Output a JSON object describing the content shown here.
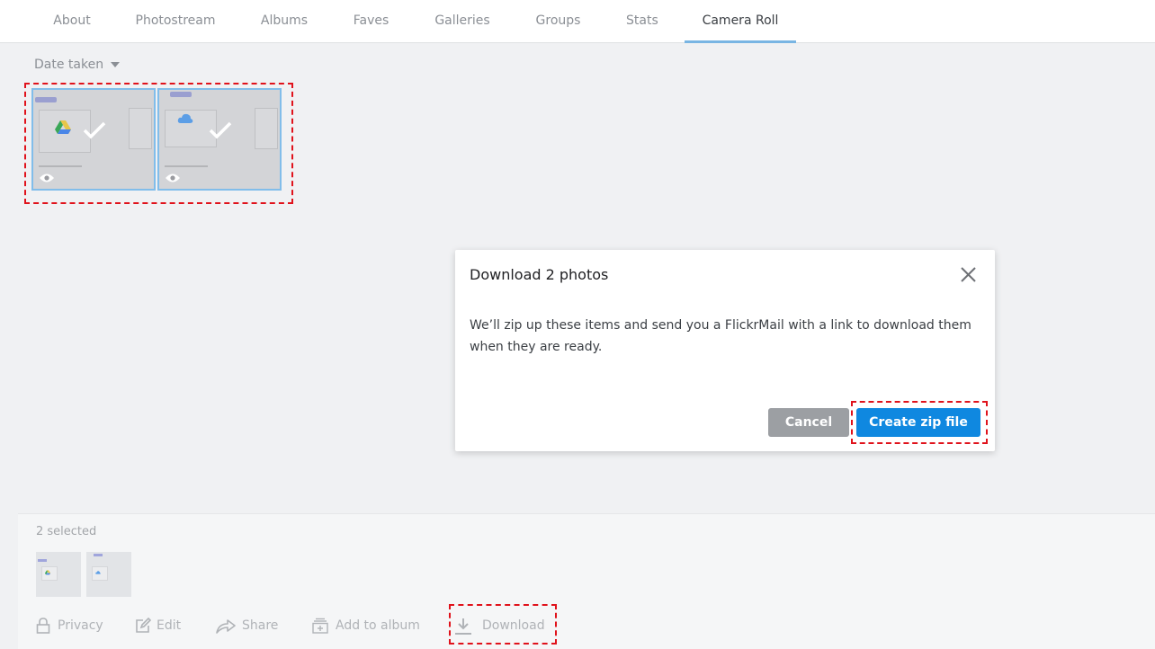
{
  "nav": {
    "tabs": [
      {
        "label": "About"
      },
      {
        "label": "Photostream"
      },
      {
        "label": "Albums"
      },
      {
        "label": "Faves"
      },
      {
        "label": "Galleries"
      },
      {
        "label": "Groups"
      },
      {
        "label": "Stats"
      },
      {
        "label": "Camera Roll"
      }
    ],
    "active_tab": "Camera Roll"
  },
  "sort": {
    "label": "Date taken"
  },
  "photos": [
    {
      "selected": true,
      "icon": "google-drive-icon"
    },
    {
      "selected": true,
      "icon": "cloud-icon"
    }
  ],
  "dialog": {
    "title": "Download 2 photos",
    "body": "We’ll zip up these items and send you a FlickrMail with a link to download them when they are ready.",
    "cancel_label": "Cancel",
    "create_label": "Create zip file"
  },
  "selection": {
    "count_label": "2 selected",
    "actions": [
      {
        "label": "Privacy",
        "icon": "lock-icon"
      },
      {
        "label": "Edit",
        "icon": "edit-icon"
      },
      {
        "label": "Share",
        "icon": "share-icon"
      },
      {
        "label": "Add to album",
        "icon": "add-to-album-icon"
      },
      {
        "label": "Download",
        "icon": "download-icon"
      }
    ]
  },
  "colors": {
    "accent": "#0f88e0",
    "highlight": "#e0121b",
    "selected_border": "#81bdea"
  }
}
